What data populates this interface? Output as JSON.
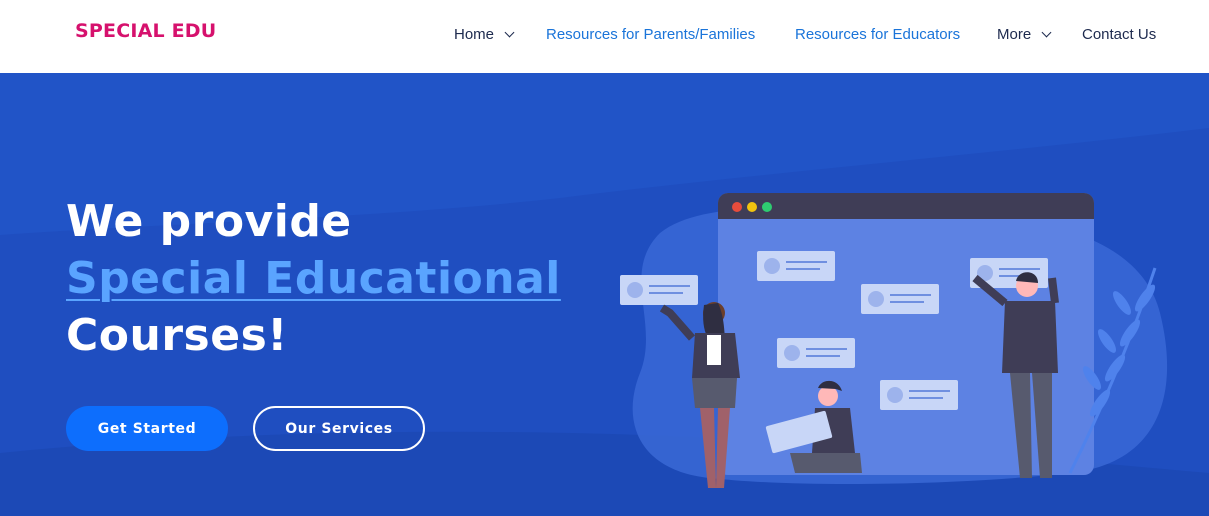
{
  "brand": {
    "name": "SPECIAL EDU"
  },
  "nav": {
    "items": [
      {
        "label": "Home",
        "dropdown": true
      },
      {
        "label": "Resources for Parents/Families",
        "dropdown": false
      },
      {
        "label": "Resources for Educators",
        "dropdown": false
      },
      {
        "label": "More",
        "dropdown": true
      },
      {
        "label": "Contact Us",
        "dropdown": false
      }
    ]
  },
  "hero": {
    "line1": "We provide",
    "line2": "Special Educational",
    "line3": "Courses!",
    "primary_button": "Get Started",
    "secondary_button": "Our Services"
  },
  "colors": {
    "brand": "#d6116d",
    "nav_text": "#1d2a4e",
    "nav_link": "#1a74d9",
    "hero_bg": "#1f4ec0",
    "highlight_text": "#5aa4ff",
    "primary_button": "#0d6efd"
  },
  "icons": [
    "chevron-down-icon"
  ]
}
